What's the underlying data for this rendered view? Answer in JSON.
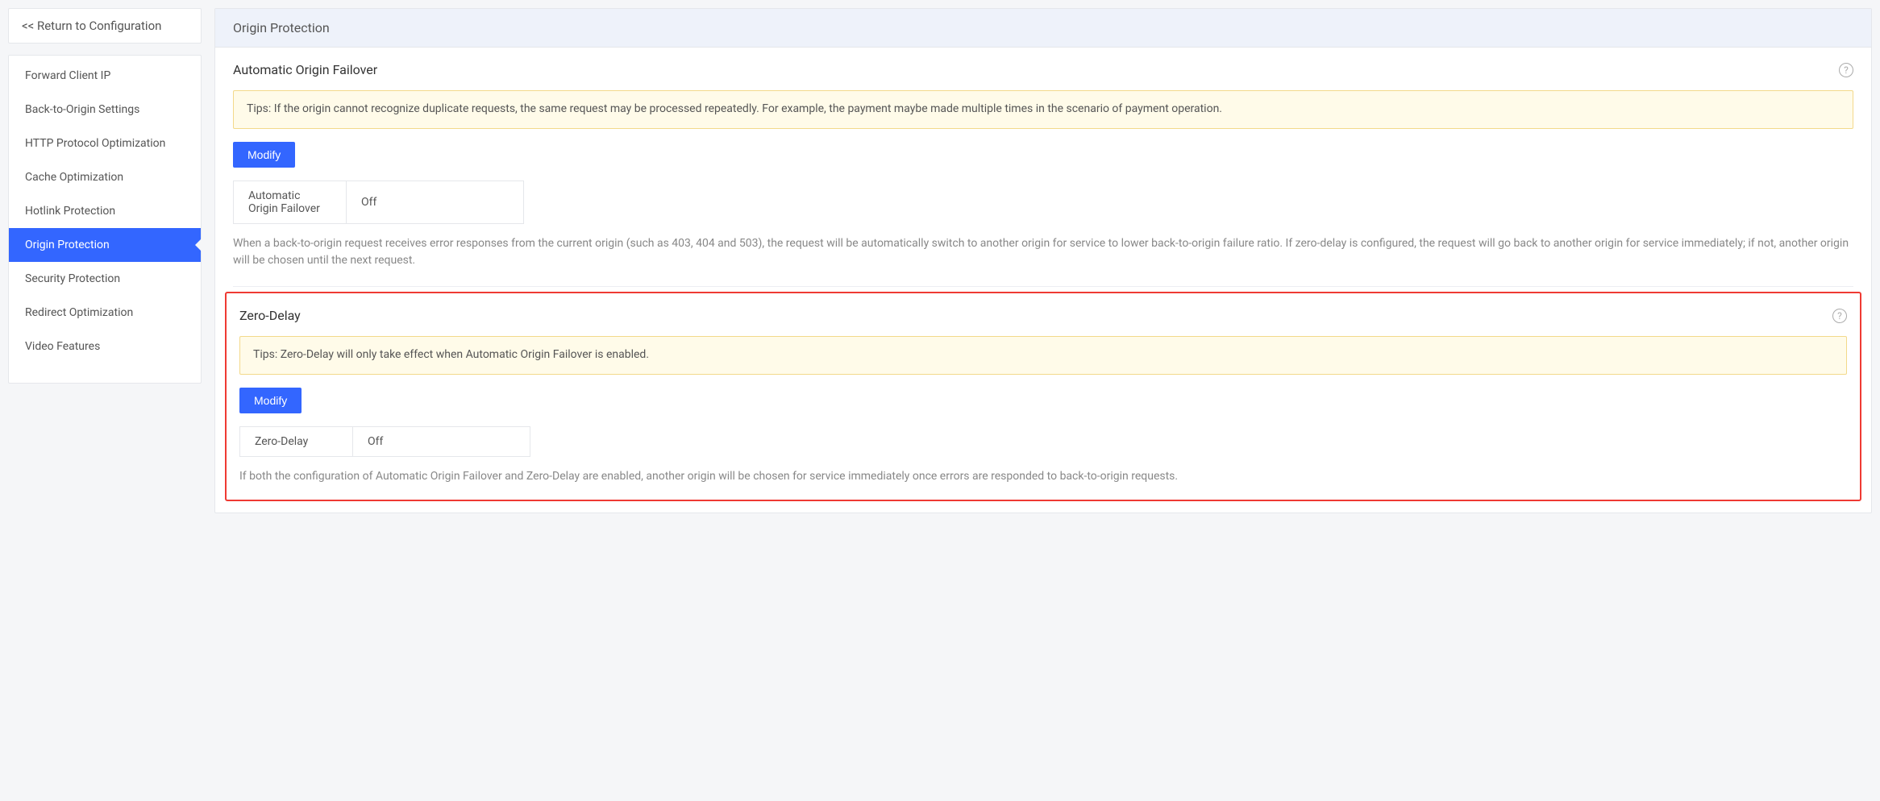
{
  "sidebar": {
    "return_label": "<< Return to Configuration",
    "items": [
      {
        "label": "Forward Client IP",
        "active": false
      },
      {
        "label": "Back-to-Origin Settings",
        "active": false
      },
      {
        "label": "HTTP Protocol Optimization",
        "active": false
      },
      {
        "label": "Cache Optimization",
        "active": false
      },
      {
        "label": "Hotlink Protection",
        "active": false
      },
      {
        "label": "Origin Protection",
        "active": true
      },
      {
        "label": "Security Protection",
        "active": false
      },
      {
        "label": "Redirect Optimization",
        "active": false
      },
      {
        "label": "Video Features",
        "active": false
      }
    ]
  },
  "main": {
    "header_title": "Origin Protection",
    "help_glyph": "?",
    "sections": {
      "failover": {
        "title": "Automatic Origin Failover",
        "tips": "Tips: If the origin cannot recognize duplicate requests, the same request may be processed repeatedly. For example, the payment maybe made multiple times in the scenario of payment operation.",
        "modify_label": "Modify",
        "status_label": "Automatic Origin Failover",
        "status_value": "Off",
        "description": "When a back-to-origin request receives error responses from the current origin (such as 403, 404 and 503), the request will be automatically switch to another origin for service to lower back-to-origin failure ratio. If zero-delay is configured, the request will go back to another origin for service immediately; if not, another origin will be chosen until the next request."
      },
      "zerodelay": {
        "title": "Zero-Delay",
        "tips": "Tips: Zero-Delay will only take effect when Automatic Origin Failover is enabled.",
        "modify_label": "Modify",
        "status_label": "Zero-Delay",
        "status_value": "Off",
        "description": "If both the configuration of Automatic Origin Failover and Zero-Delay are enabled, another origin will be chosen for service immediately once errors are responded to back-to-origin requests."
      }
    }
  }
}
